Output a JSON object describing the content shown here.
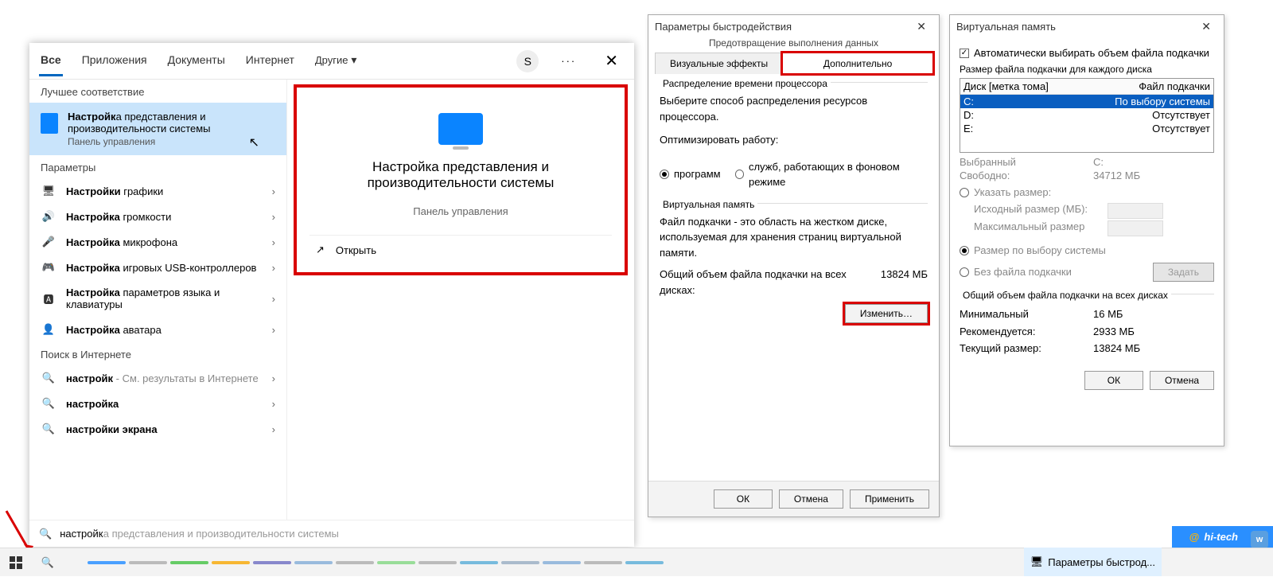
{
  "search": {
    "tabs": [
      "Все",
      "Приложения",
      "Документы",
      "Интернет",
      "Другие"
    ],
    "avatar_letter": "S",
    "best_match_header": "Лучшее соответствие",
    "best_title_prefix": "Настройк",
    "best_title_rest": "а представления и производительности системы",
    "best_sub": "Панель управления",
    "params_header": "Параметры",
    "params": [
      {
        "icon": "🖥",
        "bold": "Настройки",
        "rest": " графики"
      },
      {
        "icon": "🔊",
        "bold": "Настройка",
        "rest": " громкости"
      },
      {
        "icon": "🎤",
        "bold": "Настройка",
        "rest": " микрофона"
      },
      {
        "icon": "🎮",
        "bold": "Настройка",
        "rest": " игровых USB-контроллеров"
      },
      {
        "icon": "🅰",
        "bold": "Настройка",
        "rest": " параметров языка и клавиатуры"
      },
      {
        "icon": "👤",
        "bold": "Настройка",
        "rest": " аватара"
      }
    ],
    "web_header": "Поиск в Интернете",
    "web": [
      {
        "q": "настройк",
        "hint": " - См. результаты в Интернете"
      },
      {
        "q": "настройка",
        "hint": ""
      },
      {
        "q": "настройки экрана",
        "hint": ""
      }
    ],
    "hero_title": "Настройка представления и производительности системы",
    "hero_sub": "Панель управления",
    "hero_open": "Открыть",
    "typed": "настройк",
    "ghost": "а представления и производительности системы"
  },
  "perf": {
    "title": "Параметры быстродействия",
    "doc_header": "Предотвращение выполнения данных",
    "tab_visual": "Визуальные эффекты",
    "tab_advanced": "Дополнительно",
    "cpu_group": "Распределение времени процессора",
    "cpu_text": "Выберите способ распределения ресурсов процессора.",
    "optimize_label": "Оптимизировать работу:",
    "opt_programs": "программ",
    "opt_services": "служб, работающих в фоновом режиме",
    "vm_group": "Виртуальная память",
    "vm_text": "Файл подкачки - это область на жестком диске, используемая для хранения страниц виртуальной памяти.",
    "vm_total_label": "Общий объем файла подкачки на всех дисках:",
    "vm_total_value": "13824 МБ",
    "change_btn": "Изменить…",
    "ok": "ОК",
    "cancel": "Отмена",
    "apply": "Применить"
  },
  "vm": {
    "title": "Виртуальная память",
    "auto_chk": "Автоматически выбирать объем файла подкачки",
    "each_disk": "Размер файла подкачки для каждого диска",
    "col_disk": "Диск [метка тома]",
    "col_file": "Файл подкачки",
    "disks": [
      {
        "d": "C:",
        "v": "По выбору системы",
        "sel": true
      },
      {
        "d": "D:",
        "v": "Отсутствует"
      },
      {
        "d": "E:",
        "v": "Отсутствует"
      }
    ],
    "selected_label": "Выбранный",
    "selected_val": "C:",
    "free_label": "Свободно:",
    "free_val": "34712 МБ",
    "custom_size": "Указать размер:",
    "init_size": "Исходный размер (МБ):",
    "max_size": "Максимальный размер",
    "sys_managed": "Размер по выбору системы",
    "no_file": "Без файла подкачки",
    "set_btn": "Задать",
    "total_group": "Общий объем файла подкачки на всех дисках",
    "min_l": "Минимальный",
    "min_v": "16 МБ",
    "rec_l": "Рекомендуется:",
    "rec_v": "2933 МБ",
    "cur_l": "Текущий размер:",
    "cur_v": "13824 МБ",
    "ok": "ОК",
    "cancel": "Отмена"
  },
  "taskbar": {
    "app_label": "Параметры быстрод..."
  },
  "mark": "hi-tech"
}
